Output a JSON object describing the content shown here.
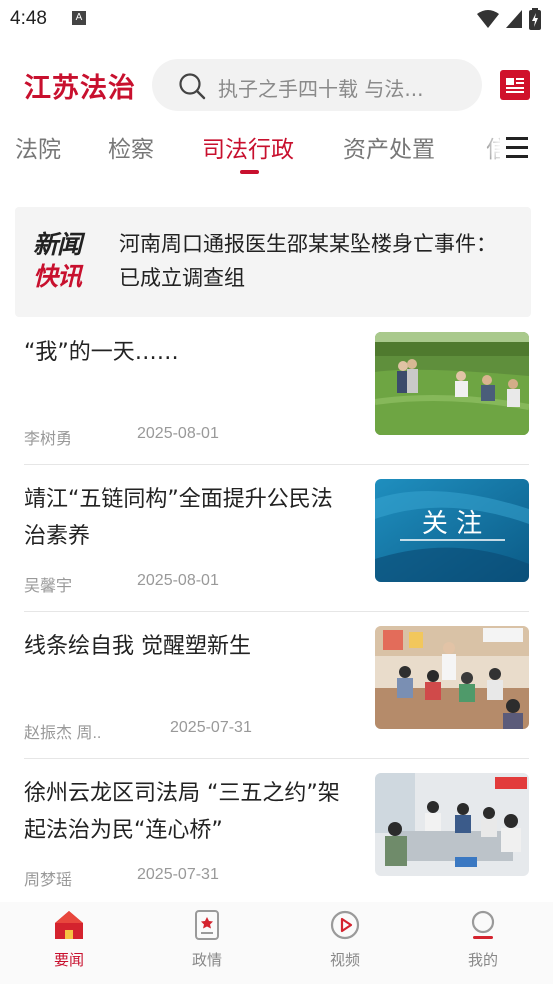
{
  "status_bar": {
    "time": "4:48",
    "notification_badge": "A"
  },
  "header": {
    "logo": "江苏法治",
    "search_placeholder": "执子之手四十载 与法..."
  },
  "tabs": [
    {
      "label": "法院"
    },
    {
      "label": "检察"
    },
    {
      "label": "司法行政",
      "active": true
    },
    {
      "label": "资产处置"
    },
    {
      "label": "信"
    }
  ],
  "flash_news": {
    "logo_line1": "新闻",
    "logo_line2": "快讯",
    "headline": "河南周口通报医生邵某某坠楼身亡事件：已成立调查组"
  },
  "news": [
    {
      "title": "“我”的一天……",
      "author": "李树勇",
      "date": "2025-08-01",
      "thumb": "field-inspection-photo"
    },
    {
      "title": "靖江“五链同构”全面提升公民法治素养",
      "author": "吴馨宇",
      "date": "2025-08-01",
      "thumb": "关 注"
    },
    {
      "title": "线条绘自我 觉醒塑新生",
      "author": "赵振杰 周..",
      "date": "2025-07-31",
      "thumb": "classroom-photo"
    },
    {
      "title": "徐州云龙区司法局 “三五之约”架起法治为民“连心桥”",
      "author": "周梦瑶",
      "date": "2025-07-31",
      "thumb": "meeting-photo"
    }
  ],
  "bottom_nav": [
    {
      "label": "要闻",
      "icon": "home-icon",
      "active": true
    },
    {
      "label": "政情",
      "icon": "document-icon"
    },
    {
      "label": "视频",
      "icon": "play-icon"
    },
    {
      "label": "我的",
      "icon": "profile-icon"
    }
  ],
  "colors": {
    "brand_red": "#c8102e",
    "background": "#ffffff",
    "muted_text": "#999999"
  }
}
